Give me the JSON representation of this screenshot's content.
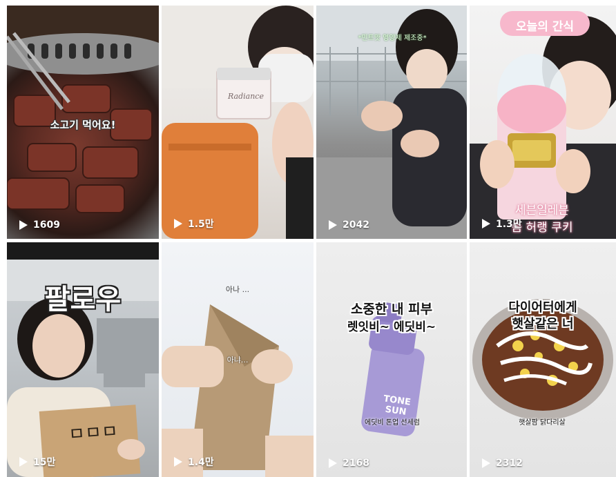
{
  "tiles": [
    {
      "caption": "소고기 먹어요!",
      "views": "1609"
    },
    {
      "caption": "Radiance",
      "views": "1.5만"
    },
    {
      "caption": "*민트맛 영양제 제조중*",
      "views": "2042"
    },
    {
      "caption_top": "오늘의 간식",
      "caption_bottom_1": "세븐일레븐",
      "caption_bottom_2": "솜 허랭 쿠키",
      "views": "1.3만"
    },
    {
      "caption": "팔로우",
      "views": "15만"
    },
    {
      "caption_top": "아나 ...",
      "caption_mid": "아냐...",
      "views": "1.4만"
    },
    {
      "caption_1": "소중한 내 피부",
      "caption_2": "렛잇비~ 에딧비~",
      "product": "TONE SUN",
      "subcaption": "에딧비 톤업 선세럼",
      "views": "2168"
    },
    {
      "caption_1": "다이어터에게",
      "caption_2": "햇살같은 너",
      "subcaption": "햇살팜 닭다리살",
      "views": "2312"
    }
  ],
  "colors": {
    "pink_badge": "#f7b8cc",
    "product_purple": "#a79ad6"
  }
}
